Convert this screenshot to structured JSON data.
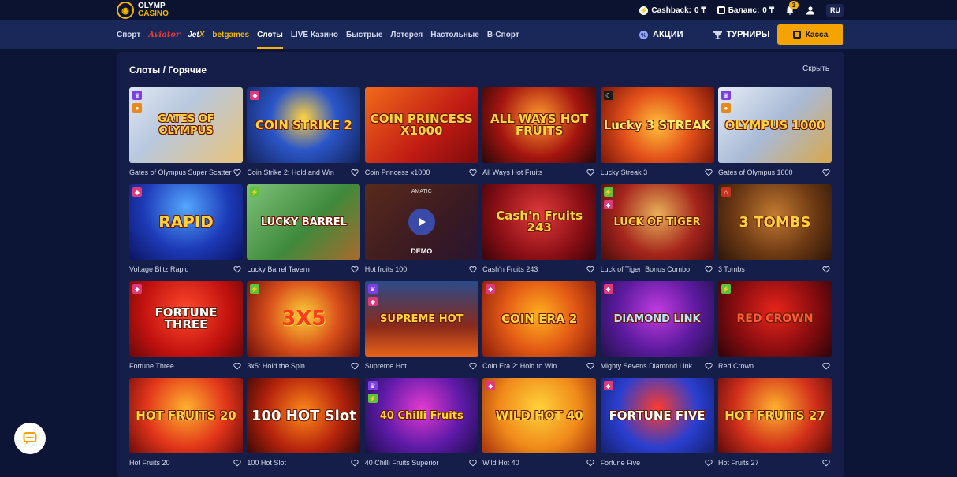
{
  "logo": {
    "line1": "OLYMP",
    "line2": "CASINO"
  },
  "topbar": {
    "cashback_label": "Cashback:",
    "cashback_value": "0 ₸",
    "balance_label": "Баланс:",
    "balance_value": "0 ₸",
    "notifications_count": "3",
    "lang": "RU"
  },
  "nav": {
    "items": [
      "Спорт",
      "Aviator",
      "Jet",
      "X",
      "betgames",
      "Слоты",
      "LIVE Казино",
      "Быстрые",
      "Лотерея",
      "Настольные",
      "В-Спорт"
    ],
    "promo": "АКЦИИ",
    "tournaments": "ТУРНИРЫ",
    "kassa": "Касса"
  },
  "section": {
    "title": "Слоты / Горячие",
    "hide": "Скрыть"
  },
  "demo_tile": {
    "provider": "AMATIC",
    "demo_label": "DEMO"
  },
  "games": [
    {
      "name": "Gates of Olympus Super Scatter",
      "art": "GATES OF OLYMPUS"
    },
    {
      "name": "Coin Strike 2: Hold and Win",
      "art": "COIN STRIKE 2"
    },
    {
      "name": "Coin Princess x1000",
      "art": "COIN PRINCESS X1000"
    },
    {
      "name": "All Ways Hot Fruits",
      "art": "ALL WAYS HOT FRUITS"
    },
    {
      "name": "Lucky Streak 3",
      "art": "Lucky 3 STREAK"
    },
    {
      "name": "Gates of Olympus 1000",
      "art": "OLYMPUS 1000"
    },
    {
      "name": "Voltage Blitz Rapid",
      "art": "RAPID"
    },
    {
      "name": "Lucky Barrel Tavern",
      "art": "LUCKY BARREL"
    },
    {
      "name": "Hot fruits 100",
      "art": ""
    },
    {
      "name": "Cash'n Fruits 243",
      "art": "Cash'n Fruits 243"
    },
    {
      "name": "Luck of Tiger: Bonus Combo",
      "art": "LUCK OF TIGER"
    },
    {
      "name": "3 Tombs",
      "art": "3 TOMBS"
    },
    {
      "name": "Fortune Three",
      "art": "FORTUNE THREE"
    },
    {
      "name": "3x5: Hold the Spin",
      "art": "3X5"
    },
    {
      "name": "Supreme Hot",
      "art": "SUPREME HOT"
    },
    {
      "name": "Coin Era 2: Hold to Win",
      "art": "COIN ERA 2"
    },
    {
      "name": "Mighty Sevens Diamond Link",
      "art": "DIAMOND LINK"
    },
    {
      "name": "Red Crown",
      "art": "RED CROWN"
    },
    {
      "name": "Hot Fruits 20",
      "art": "HOT FRUITS 20"
    },
    {
      "name": "100 Hot Slot",
      "art": "100 HOT Slot"
    },
    {
      "name": "40 Chilli Fruits Superior",
      "art": "40 Chilli Fruits"
    },
    {
      "name": "Wild Hot 40",
      "art": "WILD HOT 40"
    },
    {
      "name": "Fortune Five",
      "art": "FORTUNE FIVE"
    },
    {
      "name": "Hot Fruits 27",
      "art": "HOT FRUITS 27"
    }
  ]
}
